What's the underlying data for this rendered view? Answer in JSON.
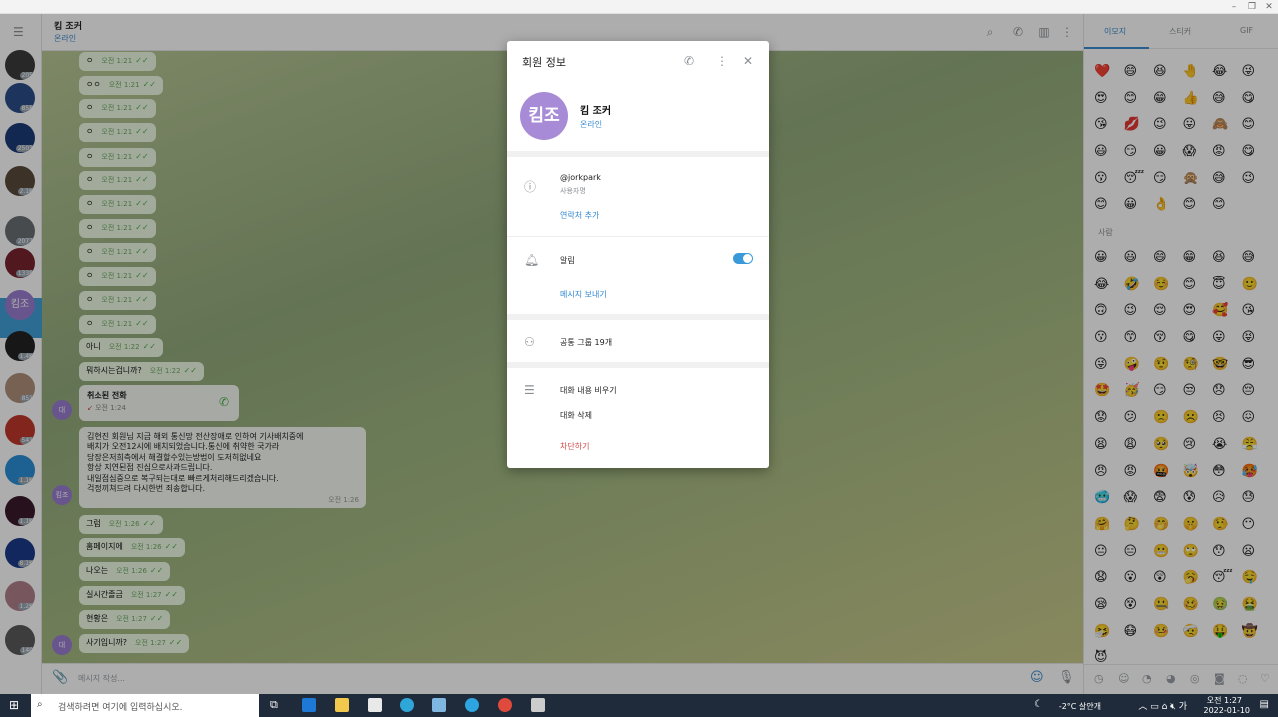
{
  "chat": {
    "name": "킴 조커",
    "status": "온라인",
    "input_placeholder": "메시지 작성..."
  },
  "left_badges": [
    "205",
    "858",
    "2503",
    "2.1K",
    "2077",
    "1338",
    "",
    "1.4K",
    "851",
    "541",
    "1.1K",
    "1.1K",
    "8.1K",
    "1.2K",
    "140"
  ],
  "selected_avatar_text": "킴조",
  "messages": [
    {
      "text": "ㅇ",
      "time": "오전 1:21"
    },
    {
      "text": "ㅇㅇ",
      "time": "오전 1:21"
    },
    {
      "text": "ㅇ",
      "time": "오전 1:21"
    },
    {
      "text": "ㅇ",
      "time": "오전 1:21"
    },
    {
      "text": "ㅇ",
      "time": "오전 1:21"
    },
    {
      "text": "ㅇ",
      "time": "오전 1:21"
    },
    {
      "text": "ㅇ",
      "time": "오전 1:21"
    },
    {
      "text": "ㅇ",
      "time": "오전 1:21"
    },
    {
      "text": "ㅇ",
      "time": "오전 1:21"
    },
    {
      "text": "ㅇ",
      "time": "오전 1:21"
    },
    {
      "text": "ㅇ",
      "time": "오전 1:21"
    },
    {
      "text": "ㅇ",
      "time": "오전 1:21"
    },
    {
      "text": "아니",
      "time": "오전 1:22"
    },
    {
      "text": "뭐하시는겁니까?",
      "time": "오전 1:22"
    }
  ],
  "call": {
    "title": "취소된 전화",
    "time": "오전 1:24",
    "avatar": "대"
  },
  "long_message": {
    "lines": [
      "김현진 회원님 지금 해외 통신망 전산장애로 인하여 기사배치중에",
      "배치가 오전12시에 배치되었습니다.통신에 취약한 국가라",
      "당장은저희측에서 해결할수있는방법이 도저히없네요",
      "항상 지연된점 진심으로사과드립니다.",
      "내일점심중으로 복구되는대로 빠르게처리해드리겠습니다.",
      "걱정끼쳐드려 다시한번 죄송합니다."
    ],
    "time": "오전 1:26",
    "avatar": "킴조"
  },
  "messages2": [
    {
      "text": "그럼",
      "time": "오전 1:26"
    },
    {
      "text": "홈페이지에",
      "time": "오전 1:26"
    },
    {
      "text": "나오는",
      "time": "오전 1:26"
    },
    {
      "text": "실시간졸금",
      "time": "오전 1:27"
    },
    {
      "text": "현황은",
      "time": "오전 1:27"
    },
    {
      "text": "사기입니까?",
      "time": "오전 1:27"
    }
  ],
  "last_avatar": "대",
  "modal": {
    "title": "회원 정보",
    "avatar_text": "킴조",
    "name": "킴 조커",
    "status": "온라인",
    "username": "@jorkpark",
    "username_label": "사용자명",
    "add_contact": "연락처 추가",
    "notifications": "알림",
    "notifications_on": true,
    "send_message": "메시지 보내기",
    "common_groups": "공통 그룹 19개",
    "clear_history": "대화 내용 비우기",
    "delete_chat": "대화 삭제",
    "block": "차단하기"
  },
  "emoji": {
    "tabs": [
      "이모지",
      "스티커",
      "GIF"
    ],
    "recent": [
      "❤️",
      "😄",
      "😆",
      "🤚",
      "😂",
      "😜",
      "😍",
      "😊",
      "😁",
      "👍",
      "😅",
      "😋",
      "😘",
      "💋",
      "😉",
      "😛",
      "🙈",
      "😊",
      "😃",
      "😏",
      "😀",
      "😱",
      "😡",
      "😋",
      "😗",
      "😴",
      "😏",
      "🙊",
      "😅",
      "😉",
      "😊",
      "😀",
      "👌",
      "😊",
      "😊"
    ],
    "section_label": "사람",
    "people": [
      "😀",
      "😃",
      "😄",
      "😁",
      "😆",
      "😅",
      "😂",
      "🤣",
      "☺️",
      "😊",
      "😇",
      "🙂",
      "🙃",
      "😉",
      "😌",
      "😍",
      "🥰",
      "😘",
      "😗",
      "😙",
      "😚",
      "😋",
      "😛",
      "😝",
      "😜",
      "🤪",
      "🤨",
      "🧐",
      "🤓",
      "😎",
      "🤩",
      "🥳",
      "😏",
      "😒",
      "😞",
      "😔",
      "😟",
      "😕",
      "🙁",
      "☹️",
      "😣",
      "😖",
      "😫",
      "😩",
      "🥺",
      "😢",
      "😭",
      "😤",
      "😠",
      "😡",
      "🤬",
      "🤯",
      "😳",
      "🥵",
      "🥶",
      "😱",
      "😨",
      "😰",
      "😥",
      "😓",
      "🤗",
      "🤔",
      "🤭",
      "🤫",
      "🤥",
      "😶",
      "😐",
      "😑",
      "😬",
      "🙄",
      "😯",
      "😦",
      "😧",
      "😮",
      "😲",
      "🥱",
      "😴",
      "🤤",
      "😪",
      "😵",
      "🤐",
      "🥴",
      "🤢",
      "🤮",
      "🤧",
      "😷",
      "🤒",
      "🤕",
      "🤑",
      "🤠",
      "😈"
    ]
  },
  "taskbar": {
    "search_placeholder": "검색하려면 여기에 입력하십시오.",
    "weather": "-2°C 살얀개",
    "time": "오전 1:27",
    "date": "2022-01-10"
  }
}
